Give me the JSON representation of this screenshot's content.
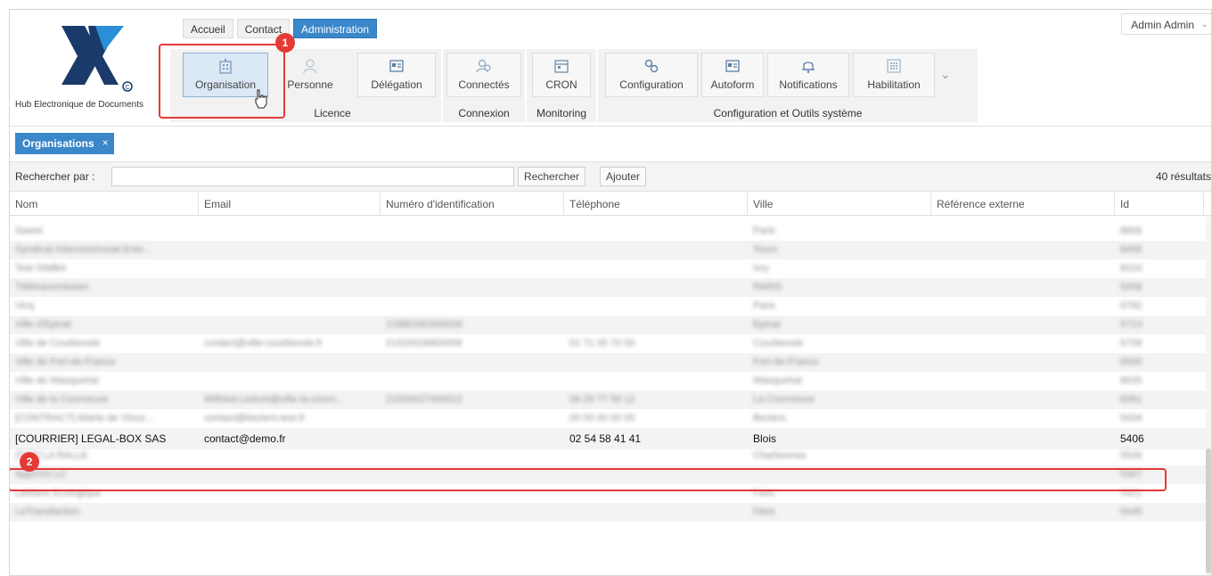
{
  "logo": {
    "tagline": "Hub Electronique de Documents"
  },
  "topnav": [
    {
      "label": "Accueil",
      "active": false
    },
    {
      "label": "Contact",
      "active": false
    },
    {
      "label": "Administration",
      "active": true
    }
  ],
  "user_menu": {
    "label": "Admin Admin"
  },
  "ribbon": {
    "groups": [
      {
        "label": "Licence",
        "buttons": [
          {
            "label": "Organisation",
            "icon": "building-icon",
            "selected": true
          },
          {
            "label": "Personne",
            "icon": "person-icon",
            "selected": false
          },
          {
            "label": "Délégation",
            "icon": "id-card-icon",
            "selected": false
          }
        ]
      },
      {
        "label": "Connexion",
        "buttons": [
          {
            "label": "Connectés",
            "icon": "users-icon",
            "selected": false
          }
        ]
      },
      {
        "label": "Monitoring",
        "buttons": [
          {
            "label": "CRON",
            "icon": "calendar-icon",
            "selected": false
          }
        ]
      },
      {
        "label": "Configuration et Outils système",
        "buttons": [
          {
            "label": "Configuration",
            "icon": "gears-icon",
            "selected": false
          },
          {
            "label": "Autoform",
            "icon": "form-icon",
            "selected": false
          },
          {
            "label": "Notifications",
            "icon": "bell-icon",
            "selected": false
          },
          {
            "label": "Habilitation",
            "icon": "grid-icon",
            "selected": false
          }
        ]
      }
    ]
  },
  "annotations": {
    "badge1": "1",
    "badge2": "2"
  },
  "doc_tab": {
    "label": "Organisations",
    "close": "×"
  },
  "search": {
    "label": "Rechercher par :",
    "value": "",
    "search_button": "Rechercher",
    "add_button": "Ajouter",
    "results": "40 résultats"
  },
  "table": {
    "columns": [
      "Nom",
      "Email",
      "Numéro d'identification",
      "Téléphone",
      "Ville",
      "Référence externe",
      "Id"
    ],
    "rows": [
      {
        "nom": "Sweet",
        "email": "",
        "num": "",
        "tel": "",
        "ville": "Paris",
        "ref": "",
        "id": "8606",
        "blur": true
      },
      {
        "nom": "Syndicat Intercommunal Ener...",
        "email": "",
        "num": "",
        "tel": "",
        "ville": "Tours",
        "ref": "",
        "id": "8456",
        "blur": true
      },
      {
        "nom": "Test SIMBA",
        "email": "",
        "num": "",
        "tel": "",
        "ville": "Ivry",
        "ref": "",
        "id": "8316",
        "blur": true
      },
      {
        "nom": "Télétransmission",
        "email": "",
        "num": "",
        "tel": "",
        "ville": "PARIS",
        "ref": "",
        "id": "5458",
        "blur": true
      },
      {
        "nom": "Vicq",
        "email": "",
        "num": "",
        "tel": "",
        "ville": "Paris",
        "ref": "",
        "id": "6782",
        "blur": true
      },
      {
        "nom": "Ville d'Epinal",
        "email": "",
        "num": "21880160300018",
        "tel": "",
        "ville": "Epinal",
        "ref": "",
        "id": "5713",
        "blur": true
      },
      {
        "nom": "Ville de Courbevoie",
        "email": "contact@ville-courbevoie.fr",
        "num": "21920026800056",
        "tel": "01 71 05 70 00",
        "ville": "Courbevoie",
        "ref": "",
        "id": "5706",
        "blur": true
      },
      {
        "nom": "Ville de Fort-de-France",
        "email": "",
        "num": "",
        "tel": "",
        "ville": "Fort-de-France",
        "ref": "",
        "id": "8500",
        "blur": true
      },
      {
        "nom": "Ville de Wasquehal",
        "email": "",
        "num": "",
        "tel": "",
        "ville": "Wasquehal",
        "ref": "",
        "id": "8635",
        "blur": true
      },
      {
        "nom": "Ville de la Courneuve",
        "email": "Wilfried.Ledure@ville-la-courn...",
        "num": "21930027400012",
        "tel": "06 29 77 59 12",
        "ville": "La Courneuve",
        "ref": "",
        "id": "8361",
        "blur": true
      },
      {
        "nom": "[CONTRACT] Mairie de Vince...",
        "email": "contact@beziers-test.fr",
        "num": "",
        "tel": "00 00 00 00 00",
        "ville": "Beziers",
        "ref": "",
        "id": "5434",
        "blur": true
      },
      {
        "nom": "[COURRIER] LEGAL-BOX SAS",
        "email": "contact@demo.fr",
        "num": "",
        "tel": "02 54 58 41 41",
        "ville": "Blois",
        "ref": "",
        "id": "5406",
        "blur": false
      },
      {
        "nom": "[TOT] LA RALLE",
        "email": "",
        "num": "",
        "tel": "",
        "ville": "Charbonnes",
        "ref": "",
        "id": "5536",
        "blur": true
      },
      {
        "nom": "ApprOrs LC",
        "email": "",
        "num": "",
        "tel": "",
        "ville": "",
        "ref": "",
        "id": "5367",
        "blur": true
      },
      {
        "nom": "LeMans Ecologique",
        "email": "",
        "num": "",
        "tel": "",
        "ville": "Fées",
        "ref": "",
        "id": "5421",
        "blur": true
      },
      {
        "nom": "LeTransfaction",
        "email": "",
        "num": "",
        "tel": "",
        "ville": "Fées",
        "ref": "",
        "id": "5445",
        "blur": true
      }
    ]
  },
  "colors": {
    "accent": "#3a87c9",
    "annotation": "#e53935"
  }
}
